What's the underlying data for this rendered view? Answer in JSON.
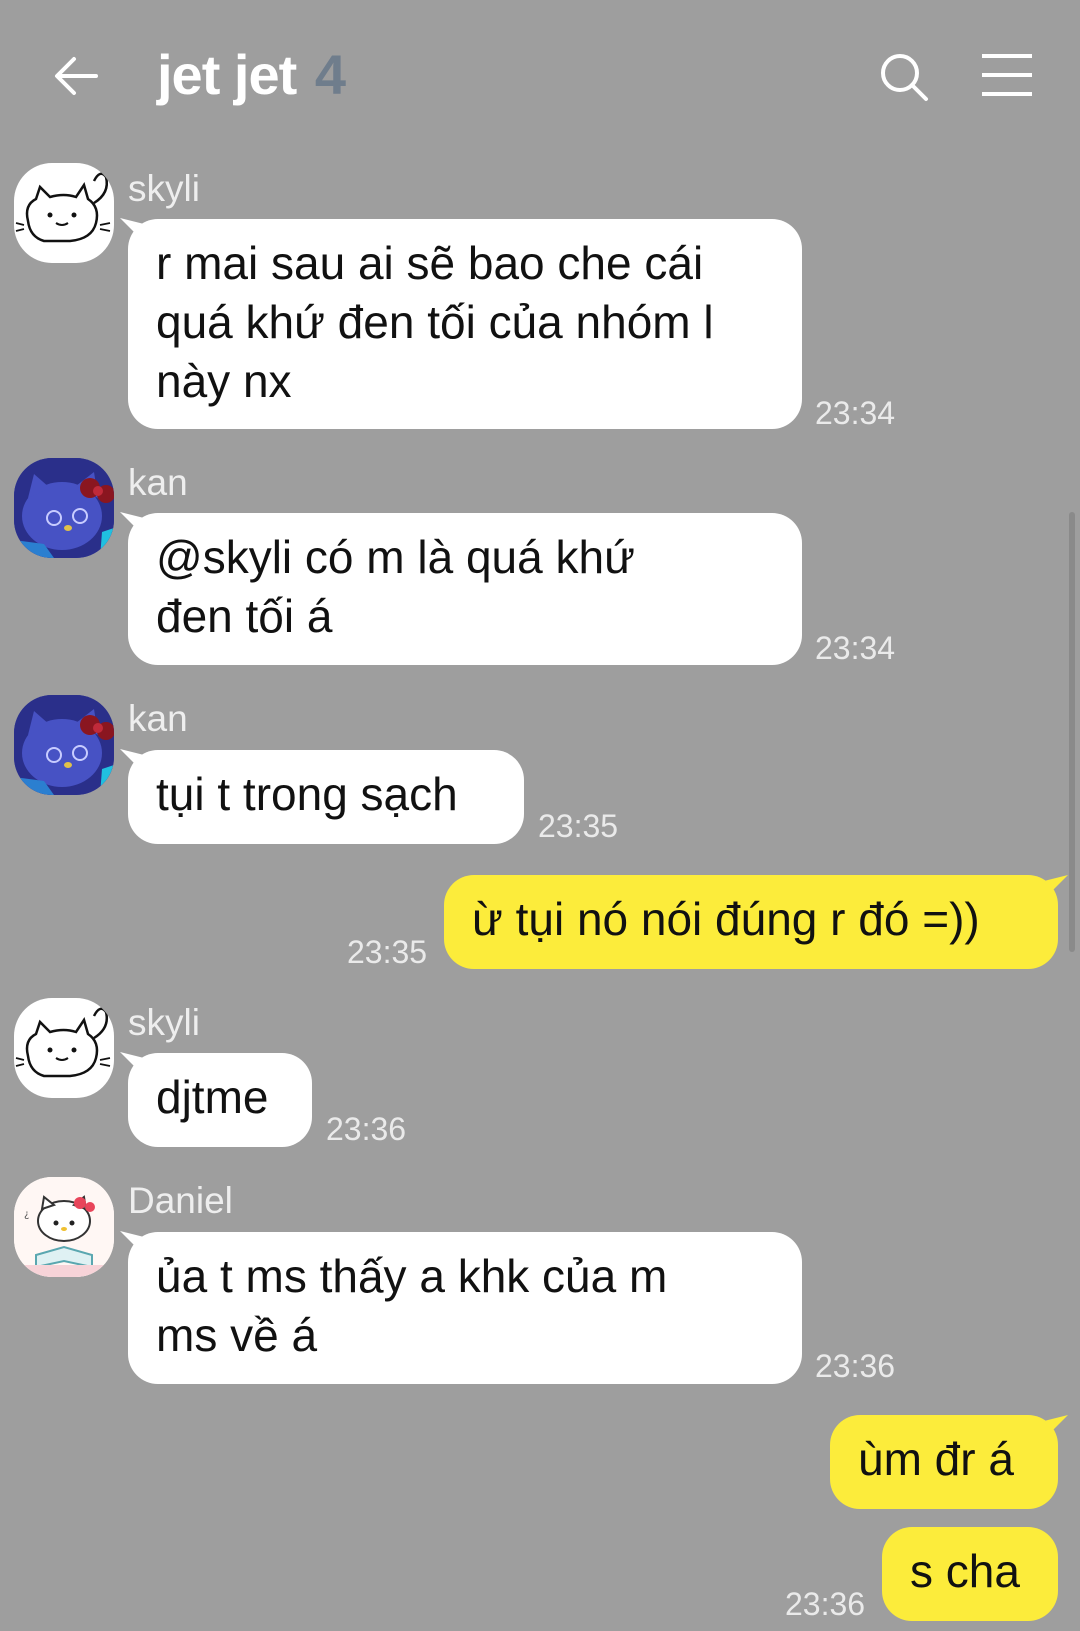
{
  "header": {
    "title": "jet jet",
    "member_count": "4",
    "back_icon": "arrow-left-icon",
    "search_icon": "search-icon",
    "menu_icon": "hamburger-menu-icon"
  },
  "colors": {
    "background": "#9e9e9e",
    "incoming_bubble": "#ffffff",
    "outgoing_bubble": "#fcec3b",
    "member_count": "#6f7d8c"
  },
  "messages": [
    {
      "sender": "skyli",
      "avatar": "cat-doodle-avatar",
      "lines": [
        "r mai sau ai sẽ bao che cái",
        "quá khứ đen tối của nhóm l",
        "này nx"
      ],
      "time": "23:34"
    },
    {
      "sender": "kan",
      "avatar": "blue-kitty-avatar",
      "lines": [
        "@skyli có m là quá khứ",
        "đen tối á"
      ],
      "time": "23:34"
    },
    {
      "sender": "kan",
      "avatar": "blue-kitty-avatar",
      "lines": [
        "tụi t trong sạch"
      ],
      "time": "23:35"
    },
    {
      "sender": "me",
      "lines": [
        "ừ tụi nó nói đúng r đó =))"
      ],
      "time": "23:35"
    },
    {
      "sender": "skyli",
      "avatar": "cat-doodle-avatar",
      "lines": [
        "djtme"
      ],
      "time": "23:36"
    },
    {
      "sender": "Daniel",
      "avatar": "hello-kitty-avatar",
      "lines": [
        "ủa t ms thấy a khk của m",
        "ms về á"
      ],
      "time": "23:36"
    },
    {
      "sender": "me",
      "lines": [
        "ùm đr á"
      ],
      "time": ""
    },
    {
      "sender": "me",
      "lines": [
        "s cha"
      ],
      "time": "23:36"
    }
  ]
}
